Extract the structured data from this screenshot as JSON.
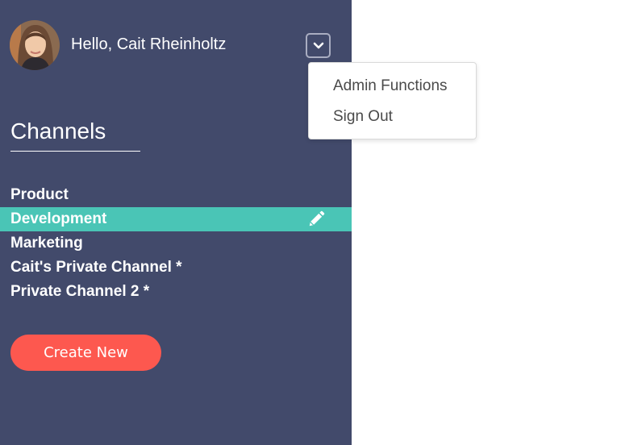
{
  "header": {
    "greeting": "Hello, Cait Rheinholtz",
    "avatar_icon": "user-photo",
    "toggle_icon": "chevron-down-icon"
  },
  "user_menu": {
    "items": [
      {
        "label": "Admin Functions"
      },
      {
        "label": "Sign Out"
      }
    ]
  },
  "channels": {
    "heading": "Channels",
    "items": [
      {
        "label": "Product",
        "active": false
      },
      {
        "label": "Development",
        "active": true,
        "action_icon": "pencil-icon"
      },
      {
        "label": "Marketing",
        "active": false
      },
      {
        "label": "Cait's Private Channel *",
        "active": false
      },
      {
        "label": "Private Channel 2 *",
        "active": false
      }
    ]
  },
  "actions": {
    "create_label": "Create New"
  },
  "colors": {
    "sidebar_bg": "#424a6b",
    "active_channel": "#4ac5b6",
    "create_button": "#fd584f",
    "menu_text": "#4a4a4a"
  }
}
